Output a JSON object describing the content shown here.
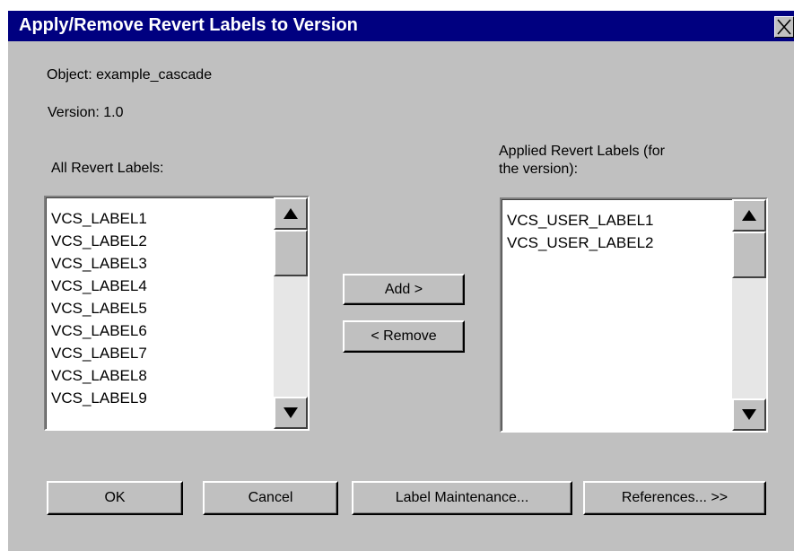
{
  "window": {
    "title": "Apply/Remove Revert Labels to Version",
    "close_icon": "close-x-icon"
  },
  "info": {
    "object_line": "Object: example_cascade",
    "version_line": "Version: 1.0"
  },
  "all_labels": {
    "heading": "All Revert  Labels:",
    "items": [
      "VCS_LABEL1",
      "VCS_LABEL2",
      "VCS_LABEL3",
      "VCS_LABEL4",
      "VCS_LABEL5",
      "VCS_LABEL6",
      "VCS_LABEL7",
      "VCS_LABEL8",
      "VCS_LABEL9"
    ]
  },
  "applied_labels": {
    "heading_line1": "Applied Revert Labels (for",
    "heading_line2": "the version):",
    "items": [
      "VCS_USER_LABEL1",
      "VCS_USER_LABEL2"
    ]
  },
  "transfer": {
    "add_label": "Add >",
    "remove_label": "< Remove"
  },
  "footer": {
    "ok_label": "OK",
    "cancel_label": "Cancel",
    "label_maintenance_label": "Label Maintenance...",
    "references_label": "References... >>"
  },
  "colors": {
    "dialog_background": "#c0c0c0",
    "title_bar": "#000080",
    "title_text": "#ffffff",
    "list_background": "#ffffff"
  }
}
